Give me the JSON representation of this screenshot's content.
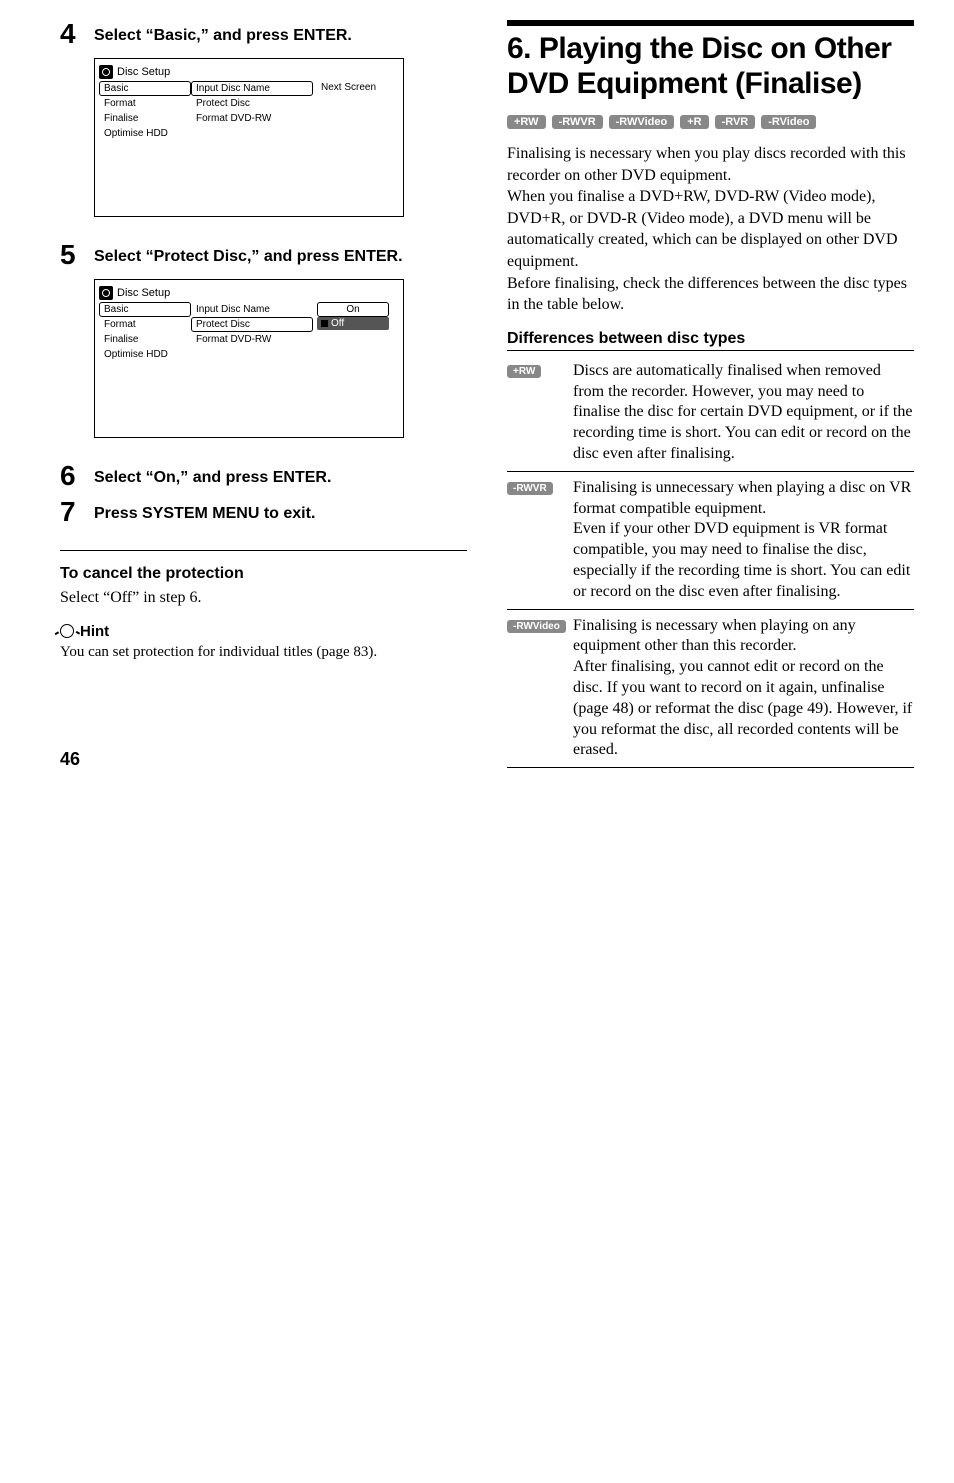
{
  "left": {
    "step4": {
      "num": "4",
      "text": "Select “Basic,” and press ENTER."
    },
    "step5": {
      "num": "5",
      "text": "Select “Protect Disc,” and press ENTER."
    },
    "step6": {
      "num": "6",
      "text": "Select “On,” and press ENTER."
    },
    "step7": {
      "num": "7",
      "text": "Press SYSTEM MENU to exit."
    },
    "screenshot1": {
      "title": "Disc Setup",
      "menu": [
        "Basic",
        "Format",
        "Finalise",
        "Optimise HDD"
      ],
      "list": [
        "Input Disc Name",
        "Protect Disc",
        "Format DVD-RW"
      ],
      "right": [
        "Next Screen"
      ]
    },
    "screenshot2": {
      "title": "Disc Setup",
      "menu": [
        "Basic",
        "Format",
        "Finalise",
        "Optimise HDD"
      ],
      "list": [
        "Input Disc Name",
        "Protect Disc",
        "Format DVD-RW"
      ],
      "right": [
        "On",
        "Off"
      ]
    },
    "cancel_heading": "To cancel the protection",
    "cancel_body": "Select “Off” in step 6.",
    "hint_label": "Hint",
    "hint_body": "You can set protection for individual titles (page 83)."
  },
  "right": {
    "title": "6. Playing the Disc on Other DVD Equipment (Finalise)",
    "badges": [
      "+RW",
      "-RWVR",
      "-RWVideo",
      "+R",
      "-RVR",
      "-RVideo"
    ],
    "para1": "Finalising is necessary when you play discs recorded with this recorder on other DVD equipment.",
    "para2": "When you finalise a DVD+RW, DVD-RW (Video mode), DVD+R, or DVD-R (Video mode), a DVD menu will be automatically created, which can be displayed on other DVD equipment.",
    "para3": "Before finalising, check the differences between the disc types in the table below.",
    "diff_heading": "Differences between disc types",
    "rows": [
      {
        "badge": "+RW",
        "text": "Discs are automatically finalised when removed from the recorder. However, you may need to finalise the disc for certain DVD equipment, or if the recording time is short. You can edit or record on the disc even after finalising."
      },
      {
        "badge": "-RWVR",
        "text": "Finalising is unnecessary when playing a disc on VR format compatible equipment.\nEven if your other DVD equipment is VR format compatible, you may need to finalise the disc, especially if the recording time is short. You can edit or record on the disc even after finalising."
      },
      {
        "badge": "-RWVideo",
        "text": "Finalising is necessary when playing on any equipment other than this recorder.\nAfter finalising, you cannot edit or record on the disc. If you want to record on it again, unfinalise (page 48) or reformat the disc (page 49). However, if you reformat the disc, all recorded contents will be erased."
      }
    ]
  },
  "page": "46"
}
